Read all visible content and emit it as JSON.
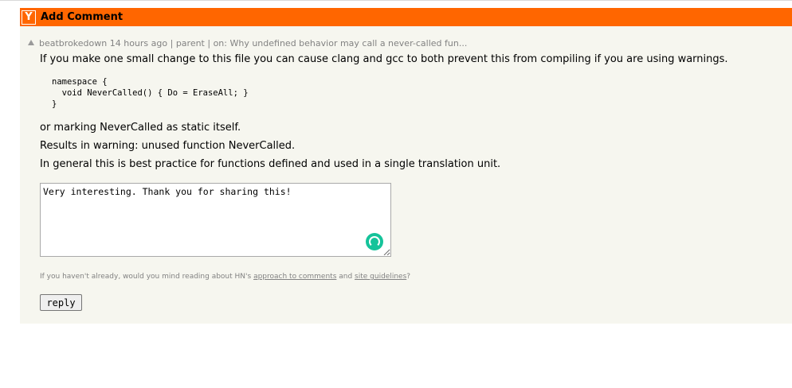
{
  "header": {
    "logo_letter": "Y",
    "title": "Add Comment"
  },
  "meta": {
    "user": "beatbrokedown",
    "age": "14 hours ago",
    "sep1": " | ",
    "parent": "parent",
    "sep2": " | on: ",
    "story": "Why undefined behavior may call a never-called fun..."
  },
  "comment": {
    "p1": "If you make one small change to this file you can cause clang and gcc to both prevent this from compiling if you are using warnings.",
    "code": "namespace {\n  void NeverCalled() { Do = EraseAll; }\n}",
    "p2": "or marking NeverCalled as static itself.",
    "p3": "Results in warning: unused function NeverCalled.",
    "p4": "In general this is best practice for functions defined and used in a single translation unit."
  },
  "reply_box": {
    "value": "Very interesting. Thank you for sharing this!"
  },
  "note": {
    "prefix": "If you haven't already, would you mind reading about HN's ",
    "link1": "approach to comments",
    "middle": " and ",
    "link2": "site guidelines",
    "suffix": "?"
  },
  "reply_button": {
    "label": "reply"
  },
  "colors": {
    "header_bg": "#ff6600",
    "content_bg": "#f6f6ef",
    "meta_text": "#828282",
    "grammar_icon": "#15c39a"
  },
  "icons": [
    "hn-logo-icon",
    "upvote-arrow-icon",
    "grammarly-icon",
    "resize-grip-icon"
  ]
}
